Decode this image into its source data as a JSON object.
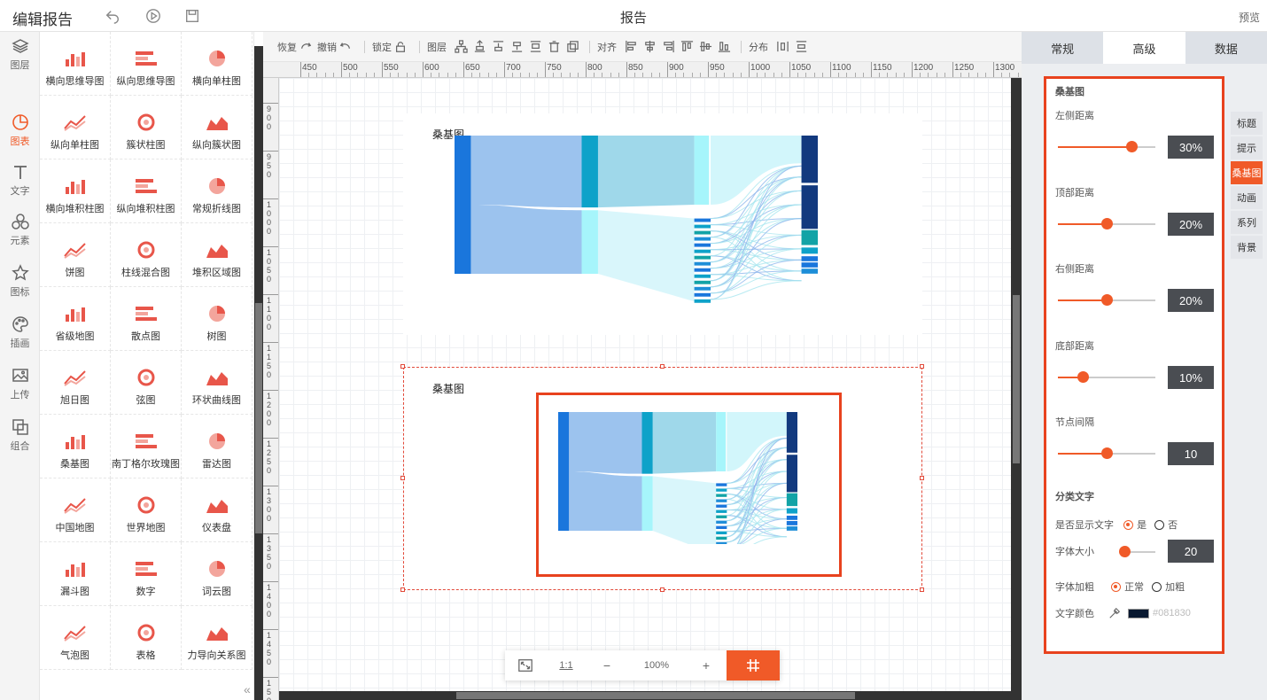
{
  "topbar": {
    "app_title": "编辑报告",
    "doc_title": "报告",
    "preview": "预览"
  },
  "leftnav": {
    "items": [
      {
        "label": "图层",
        "icon": "layers-icon"
      },
      {
        "label": "图表",
        "icon": "chart-icon",
        "active": true
      },
      {
        "label": "文字",
        "icon": "text-icon"
      },
      {
        "label": "元素",
        "icon": "elements-icon"
      },
      {
        "label": "图标",
        "icon": "star-icon"
      },
      {
        "label": "插画",
        "icon": "palette-icon"
      },
      {
        "label": "上传",
        "icon": "upload-image-icon"
      },
      {
        "label": "组合",
        "icon": "group-icon"
      }
    ]
  },
  "palette": {
    "items": [
      "横向思维导图",
      "纵向思维导图",
      "横向单柱图",
      "纵向单柱图",
      "簇状柱图",
      "纵向簇状图",
      "横向堆积柱图",
      "纵向堆积柱图",
      "常规折线图",
      "饼图",
      "柱线混合图",
      "堆积区域图",
      "省级地图",
      "散点图",
      "树图",
      "旭日图",
      "弦图",
      "环状曲线图",
      "桑基图",
      "南丁格尔玫瑰图",
      "雷达图",
      "中国地图",
      "世界地图",
      "仪表盘",
      "漏斗图",
      "数字",
      "词云图",
      "气泡图",
      "表格",
      "力导向关系图"
    ]
  },
  "toolbar": {
    "redo": "恢复",
    "undo": "撤销",
    "lock": "锁定",
    "layer": "图层",
    "align": "对齐",
    "distribute": "分布"
  },
  "ruler": {
    "top_labels": [
      "450",
      "500",
      "550",
      "600",
      "650",
      "700",
      "750",
      "800",
      "850",
      "900",
      "950",
      "1000",
      "1050",
      "1100",
      "1150",
      "1200",
      "1250",
      "1300"
    ],
    "left_labels": [
      "900",
      "950",
      "1000",
      "1050",
      "1100",
      "1150",
      "1200",
      "1250",
      "1300",
      "1350",
      "1400",
      "1450",
      "1500"
    ]
  },
  "chart1": {
    "title": "桑基图"
  },
  "chart2": {
    "title": "桑基图"
  },
  "zoombar": {
    "fit": "fit-screen-icon",
    "one_to_one": "1:1",
    "minus": "−",
    "zoom": "100%",
    "plus": "+",
    "grid": "grid-icon"
  },
  "right_tabs": [
    "常规",
    "高级",
    "数据"
  ],
  "props": {
    "section_title": "桑基图",
    "left_label": "左侧距离",
    "left_value": "30%",
    "left_pos": 0.75,
    "top_label": "顶部距离",
    "top_value": "20%",
    "top_pos": 0.5,
    "right_label": "右侧距离",
    "right_value": "20%",
    "right_pos": 0.5,
    "bottom_label": "底部距离",
    "bottom_value": "10%",
    "bottom_pos": 0.25,
    "gap_label": "节点间隔",
    "gap_value": "10",
    "gap_pos": 0.5,
    "cat_title": "分类文字",
    "show_label": "是否显示文字",
    "show_yes": "是",
    "show_no": "否",
    "size_label": "字体大小",
    "size_value": "20",
    "size_pos": 0.07,
    "bold_label": "字体加粗",
    "bold_normal": "正常",
    "bold_bold": "加粗",
    "color_label": "文字颜色",
    "color_value": "#081830"
  },
  "side_tabs": [
    "标题",
    "提示",
    "桑基图",
    "动画",
    "系列",
    "背景"
  ],
  "colors": {
    "accent": "#f05a28",
    "highlight": "#e8421e"
  }
}
